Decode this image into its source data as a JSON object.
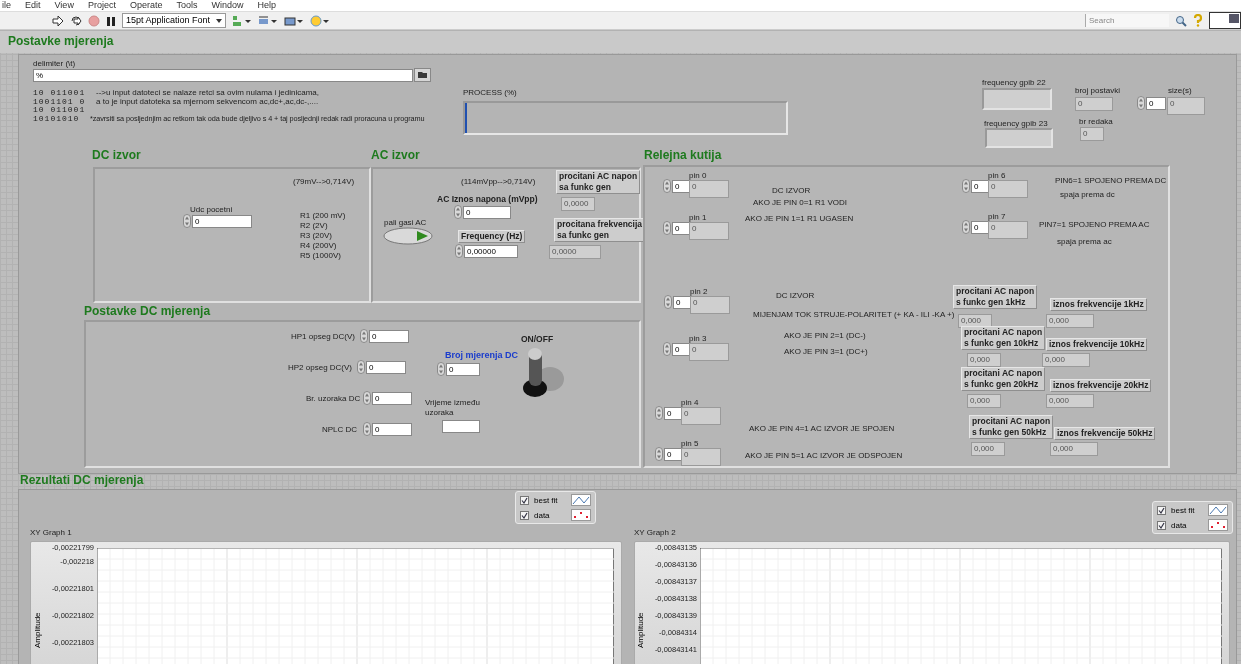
{
  "menu": [
    "ile",
    "Edit",
    "View",
    "Project",
    "Operate",
    "Tools",
    "Window",
    "Help"
  ],
  "toolbar": {
    "font": "15pt Application Font",
    "search": {
      "placeholder": "Search"
    }
  },
  "settings": {
    "title": "Postavke mjerenja",
    "delimiter": {
      "label": "delimiter (\\t)",
      "value": "%"
    },
    "binary_lines": [
      "10 011001",
      "1001101 0",
      "10 011001",
      "10101010"
    ],
    "notes": [
      "-->u input datoteci se nalaze retci sa ovim nulama i jedinicama,",
      "a to je input datoteka sa mjernom sekvencom ac,dc+,ac,dc-,....",
      "*zavrsiti sa posljednjim ac retkom tak oda bude djeljivo s 4 + taj posljednji redak radi proracuna u programu"
    ],
    "process": {
      "label": "PROCESS (%)",
      "level": 0
    },
    "gpib": [
      "frequency gpib 22",
      "frequency gpib 23"
    ],
    "broj_postavki": {
      "label": "broj postavki",
      "value": "0"
    },
    "br_redaka": {
      "label": "br redaka",
      "value": "0"
    },
    "size": {
      "label": "size(s)",
      "control": "0",
      "indicator": "0"
    }
  },
  "dc_source": {
    "title": "DC izvor",
    "range": "(79mV-->0,714V)",
    "start": {
      "label": "Udc pocetni",
      "value": "0"
    },
    "ranges": [
      "R1 (200 mV)",
      "R2 (2V)",
      "R3 (20V)",
      "R4 (200V)",
      "R5 (1000V)"
    ]
  },
  "ac_source": {
    "title": "AC izvor",
    "range": "(114mVpp-->0,714V)",
    "switch": {
      "label": "pali gasi AC",
      "on": true
    },
    "amplitude": {
      "label": "AC Iznos napona (mVpp)",
      "value": "0"
    },
    "frequency": {
      "label": "Frequency (Hz)",
      "value": "0,00000"
    },
    "read_voltage": {
      "label": "procitani AC napon\nsa funkc gen",
      "value": "0,0000"
    },
    "read_frequency": {
      "label": "procitana frekvencija\nsa funkc gen",
      "value": "0,0000"
    }
  },
  "dc_settings": {
    "title": "Postavke DC mjerenja",
    "fields": [
      {
        "label": "HP1 opseg DC(V)",
        "value": "0"
      },
      {
        "label": "HP2 opseg DC(V)",
        "value": "0"
      },
      {
        "label": "Br. uzoraka DC",
        "value": "0"
      },
      {
        "label": "NPLC DC",
        "value": "0"
      }
    ],
    "count": {
      "label": "Broj mjerenja DC",
      "value": "0"
    },
    "interval": {
      "label": "Vrijeme između\nuzoraka"
    },
    "switch": {
      "label": "ON/OFF",
      "on": true
    }
  },
  "relay": {
    "title": "Relejna kutija",
    "pins": [
      {
        "label": "pin 0",
        "control": "0",
        "indicator": "0"
      },
      {
        "label": "pin 1",
        "control": "0",
        "indicator": "0"
      },
      {
        "label": "pin 2",
        "control": "0",
        "indicator": "0"
      },
      {
        "label": "pin 3",
        "control": "0",
        "indicator": "0"
      },
      {
        "label": "pin 4",
        "control": "0",
        "indicator": "0"
      },
      {
        "label": "pin 5",
        "control": "0",
        "indicator": "0"
      },
      {
        "label": "pin 6",
        "control": "0",
        "indicator": "0"
      },
      {
        "label": "pin 7",
        "control": "0",
        "indicator": "0"
      }
    ],
    "notes": [
      "DC IZVOR",
      "AKO JE PIN 0=1 R1 VODI",
      "AKO JE PIN 1=1  R1 UGASEN",
      "DC IZVOR",
      "MIJENJAM TOK STRUJE-POLARITET (+ KA - ILI -KA +)",
      "AKO JE PIN 2=1 (DC-)",
      "AKO JE PIN 3=1 (DC+)",
      "AKO JE PIN 4=1 AC IZVOR JE SPOJEN",
      "AKO JE PIN 5=1 AC IZVOR JE ODSPOJEN",
      "PIN6=1 SPOJENO PREMA DC",
      "spaja prema dc",
      "PIN7=1 SPOJENO PREMA AC",
      "spaja prema ac"
    ],
    "readings": [
      {
        "voltage_label": "procitani AC napon\ns funkc gen 1kHz",
        "voltage": "0,000",
        "frequency_label": "iznos frekvencije 1kHz",
        "frequency": "0,000"
      },
      {
        "voltage_label": "procitani AC napon\ns funkc gen 10kHz",
        "voltage": "0,000",
        "frequency_label": "iznos frekvencije 10kHz",
        "frequency": "0,000"
      },
      {
        "voltage_label": "procitani AC napon\ns funkc gen 20kHz",
        "voltage": "0,000",
        "frequency_label": "iznos frekvencije 20kHz",
        "frequency": "0,000"
      },
      {
        "voltage_label": "procitani AC napon\ns funkc gen 50kHz",
        "voltage": "0,000",
        "frequency_label": "iznos frekvencije 50kHz",
        "frequency": "0,000"
      }
    ]
  },
  "results": {
    "title": "Rezultati DC mjerenja",
    "graphs": [
      {
        "title": "XY Graph 1",
        "y_label": "Amplitude",
        "y_tick_labels": [
          "-0,00221799",
          "-0,002218",
          "-0,00221801",
          "-0,00221802",
          "-0,00221803"
        ],
        "legend": [
          {
            "label": "best fit",
            "checked": true,
            "kind": "line"
          },
          {
            "label": "data",
            "checked": true,
            "kind": "points"
          }
        ]
      },
      {
        "title": "XY Graph 2",
        "y_label": "Amplitude",
        "y_tick_labels": [
          "-0,00843135",
          "-0,00843136",
          "-0,00843137",
          "-0,00843138",
          "-0,00843139",
          "-0,0084314",
          "-0,00843141"
        ],
        "legend": [
          {
            "label": "best fit",
            "checked": true,
            "kind": "line"
          },
          {
            "label": "data",
            "checked": true,
            "kind": "points"
          }
        ]
      }
    ]
  }
}
